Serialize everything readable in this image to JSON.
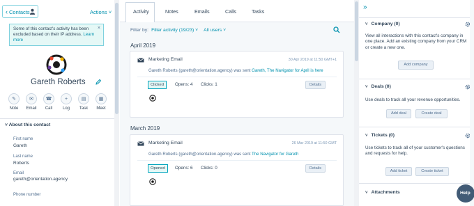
{
  "left": {
    "back_label": "Contacts",
    "actions_label": "Actions",
    "notice_text": "Some of this contact's activity has been excluded based on their IP address.",
    "notice_link": "Learn more",
    "contact_name": "Gareth Roberts",
    "action_buttons": [
      {
        "label": "Note",
        "icon": "note-icon"
      },
      {
        "label": "Email",
        "icon": "email-icon"
      },
      {
        "label": "Call",
        "icon": "phone-icon"
      },
      {
        "label": "Log",
        "icon": "plus-icon"
      },
      {
        "label": "Task",
        "icon": "task-icon"
      },
      {
        "label": "Meet",
        "icon": "calendar-icon"
      }
    ],
    "about_title": "About this contact",
    "fields": [
      {
        "label": "First name",
        "value": "Gareth"
      },
      {
        "label": "Last name",
        "value": "Roberts"
      },
      {
        "label": "Email",
        "value": "gareth@orientation.agency"
      },
      {
        "label": "Phone number",
        "value": ""
      }
    ]
  },
  "middle": {
    "tabs": [
      "Activity",
      "Notes",
      "Emails",
      "Calls",
      "Tasks"
    ],
    "filter_label": "Filter by:",
    "filter_activity": "Filter activity (19/23)",
    "filter_users": "All users",
    "groups": [
      {
        "month": "April 2019",
        "card": {
          "title": "Marketing Email",
          "date": "30 Apr 2019 at 11:50 GMT+1",
          "body_prefix": "Gareth Roberts (gareth@orientation.agency) was sent",
          "body_link": "Gareth, The Navigator for April is here",
          "status": "Clicked",
          "opens": "Opens: 4",
          "clicks": "Clicks: 1",
          "details": "Details"
        }
      },
      {
        "month": "March 2019",
        "card": {
          "title": "Marketing Email",
          "date": "26 Mar 2019 at 11:50 GMT",
          "body_prefix": "Gareth Roberts (gareth@orientation.agency) was sent",
          "body_link": "The Navigator for Gareth",
          "status": "Opened",
          "opens": "Opens: 6",
          "clicks": "Clicks: 0",
          "details": "Details"
        }
      }
    ]
  },
  "right": {
    "sections": [
      {
        "title": "Company (0)",
        "text": "View all interactions with this contact's company in one place. Add an existing company from your CRM or create a new one.",
        "buttons": [
          "Add company"
        ]
      },
      {
        "title": "Deals (0)",
        "text": "Use deals to track all your revenue opportunities.",
        "buttons": [
          "Add deal",
          "Create deal"
        ]
      },
      {
        "title": "Tickets (0)",
        "text": "Use tickets to track all of your customer's questions and requests for help.",
        "buttons": [
          "Add ticket",
          "Create ticket"
        ]
      },
      {
        "title": "Attachments",
        "text": "",
        "buttons": []
      }
    ],
    "help_label": "Help"
  },
  "colors": {
    "link": "#0091ae",
    "text": "#33475b",
    "notice_bg": "#e5f8f6",
    "help_bg": "#425b76"
  }
}
